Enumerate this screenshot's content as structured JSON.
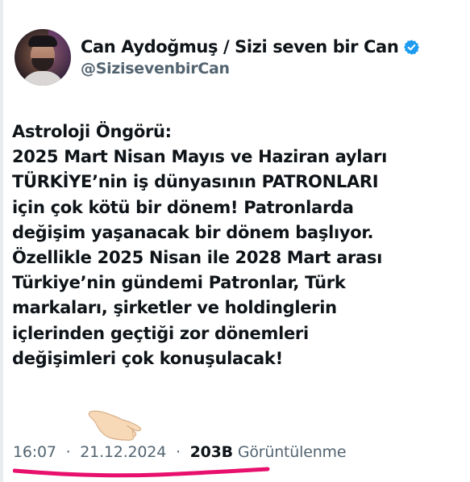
{
  "author": {
    "display_name": "Can Aydoğmuş / Sizi seven bir Can",
    "handle": "@SizisevenbirCan",
    "verified": true,
    "avatar_icon": "profile-photo"
  },
  "tweet": {
    "lines": [
      "Astroloji Öngörü:",
      "2025 Mart Nisan Mayıs ve Haziran ayları",
      "TÜRKİYE’nin iş dünyasının PATRONLARI",
      "için çok kötü bir dönem! Patronlarda",
      "değişim yaşanacak bir dönem başlıyor.",
      "Özellikle 2025 Nisan ile 2028 Mart arası",
      "Türkiye’nin gündemi Patronlar, Türk",
      "markaları, şirketler ve holdinglerin",
      "içlerinden geçtiği zor dönemleri",
      "değişimleri çok konuşulacak!"
    ]
  },
  "meta": {
    "time": "16:07",
    "separator": "·",
    "date": "21.12.2024",
    "views_count": "203B",
    "views_label": "Görüntülenme"
  },
  "annotations": {
    "pointing_hand_icon": "pointing-hand-emoji",
    "underline_color": "#e8106d"
  },
  "colors": {
    "text_primary": "#0f1419",
    "text_secondary": "#536471",
    "verified_blue": "#1d9bf0"
  }
}
